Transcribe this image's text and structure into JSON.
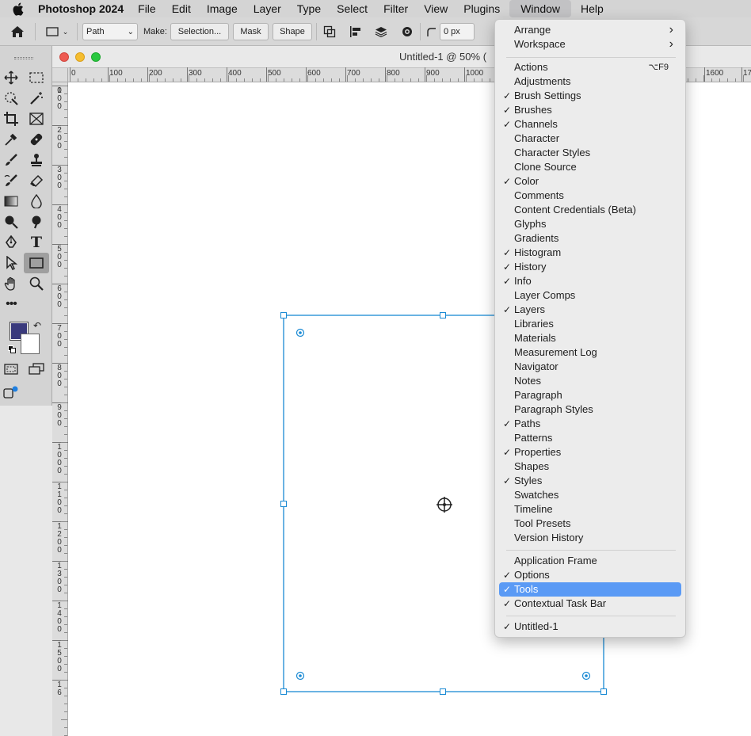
{
  "menubar": {
    "items": [
      "Photoshop 2024",
      "File",
      "Edit",
      "Image",
      "Layer",
      "Type",
      "Select",
      "Filter",
      "View",
      "Plugins",
      "Window",
      "Help"
    ],
    "active": "Window"
  },
  "options_bar": {
    "mode_value": "Path",
    "make_label": "Make:",
    "selection_btn": "Selection...",
    "mask_btn": "Mask",
    "shape_btn": "Shape",
    "radius_value": "0 px"
  },
  "document": {
    "title": "Untitled-1 @ 50% (",
    "ruler_h": [
      "0",
      "100",
      "200",
      "300",
      "400",
      "500",
      "600",
      "700",
      "800",
      "900",
      "1000",
      "1600",
      "17"
    ],
    "ruler_v": [
      "1\n0\n0",
      "2\n0\n0",
      "3\n0\n0",
      "4\n0\n0",
      "5\n0\n0",
      "6\n0\n0",
      "7\n0\n0",
      "8\n0\n0",
      "9\n0\n0",
      "1\n0\n0\n0",
      "1\n1\n0\n0",
      "1\n2\n0\n0",
      "1\n3\n0\n0",
      "1\n4\n0\n0",
      "1\n5\n0\n0",
      "1\n6"
    ]
  },
  "colors": {
    "foreground": "#3a3a7c",
    "background": "#ffffff",
    "path_stroke": "#1a8ad4",
    "highlight": "#5a9af5"
  },
  "window_menu": {
    "items": [
      {
        "label": "Arrange",
        "check": false,
        "submenu": true
      },
      {
        "label": "Workspace",
        "check": false,
        "submenu": true
      },
      {
        "label": "Actions",
        "check": false,
        "shortcut": "⌥F9"
      },
      {
        "label": "Adjustments",
        "check": false
      },
      {
        "label": "Brush Settings",
        "check": true
      },
      {
        "label": "Brushes",
        "check": true
      },
      {
        "label": "Channels",
        "check": true
      },
      {
        "label": "Character",
        "check": false
      },
      {
        "label": "Character Styles",
        "check": false
      },
      {
        "label": "Clone Source",
        "check": false
      },
      {
        "label": "Color",
        "check": true
      },
      {
        "label": "Comments",
        "check": false
      },
      {
        "label": "Content Credentials (Beta)",
        "check": false
      },
      {
        "label": "Glyphs",
        "check": false
      },
      {
        "label": "Gradients",
        "check": false
      },
      {
        "label": "Histogram",
        "check": true
      },
      {
        "label": "History",
        "check": true
      },
      {
        "label": "Info",
        "check": true
      },
      {
        "label": "Layer Comps",
        "check": false
      },
      {
        "label": "Layers",
        "check": true
      },
      {
        "label": "Libraries",
        "check": false
      },
      {
        "label": "Materials",
        "check": false
      },
      {
        "label": "Measurement Log",
        "check": false
      },
      {
        "label": "Navigator",
        "check": false
      },
      {
        "label": "Notes",
        "check": false
      },
      {
        "label": "Paragraph",
        "check": false
      },
      {
        "label": "Paragraph Styles",
        "check": false
      },
      {
        "label": "Paths",
        "check": true
      },
      {
        "label": "Patterns",
        "check": false
      },
      {
        "label": "Properties",
        "check": true
      },
      {
        "label": "Shapes",
        "check": false
      },
      {
        "label": "Styles",
        "check": true
      },
      {
        "label": "Swatches",
        "check": false
      },
      {
        "label": "Timeline",
        "check": false
      },
      {
        "label": "Tool Presets",
        "check": false
      },
      {
        "label": "Version History",
        "check": false
      },
      {
        "label": "Application Frame",
        "check": false
      },
      {
        "label": "Options",
        "check": true
      },
      {
        "label": "Tools",
        "check": true,
        "highlighted": true
      },
      {
        "label": "Contextual Task Bar",
        "check": true
      },
      {
        "label": "Untitled-1",
        "check": true
      }
    ],
    "check_glyph": "✓",
    "submenu_glyph": "›"
  }
}
